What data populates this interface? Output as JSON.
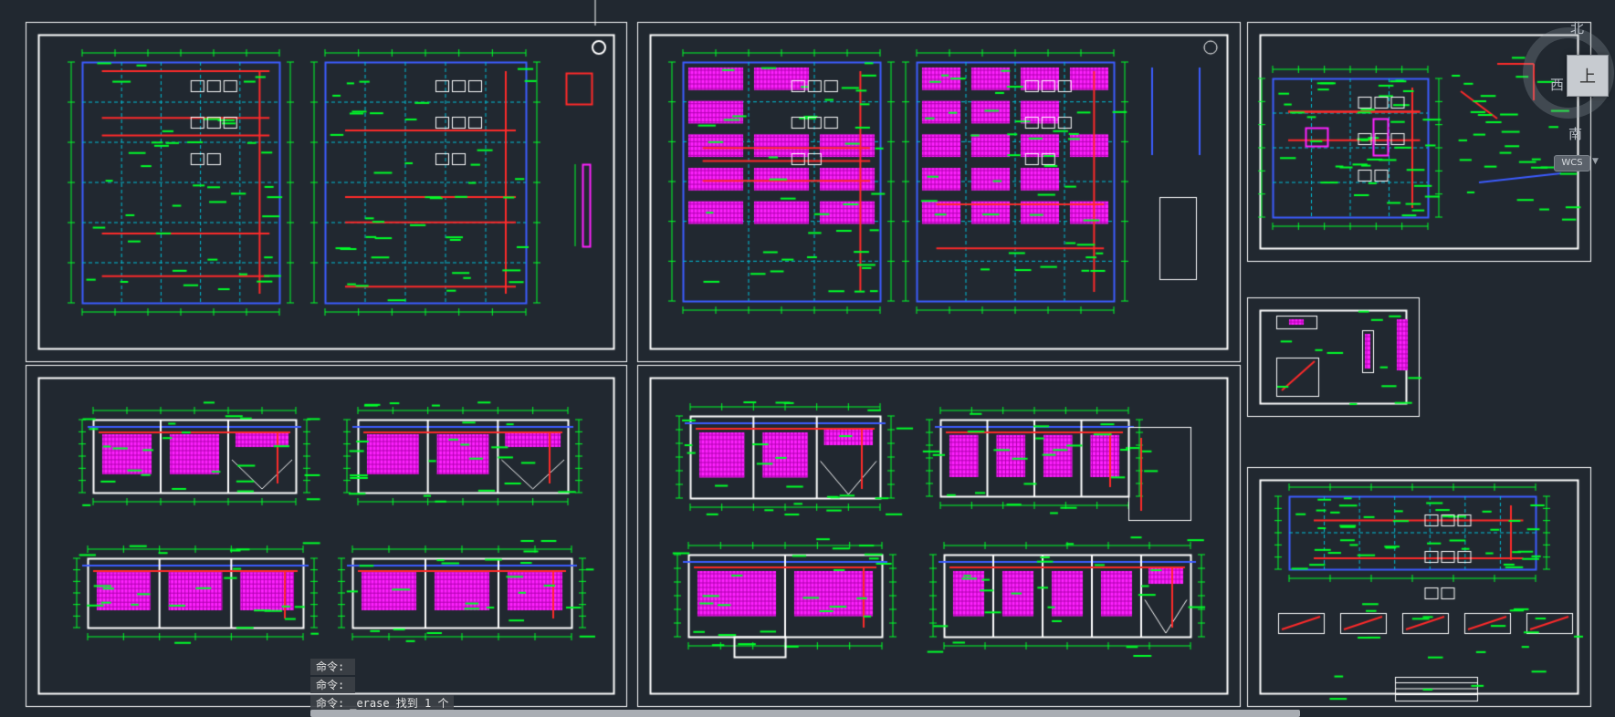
{
  "command_history": [
    {
      "prompt": "命令:",
      "text": ""
    },
    {
      "prompt": "命令:",
      "text": ""
    },
    {
      "prompt": "命令:",
      "text": "_erase 找到 1 个"
    }
  ],
  "viewcube": {
    "north": "北",
    "west": "西",
    "south": "南",
    "face": "上",
    "wcs": "WCS"
  },
  "colors": {
    "background": "#212830",
    "sheet_border": "#ffffff",
    "dimension": "#00ff2a",
    "wall_blue": "#3c5cff",
    "pipe_red": "#ff2a2a",
    "hatch_magenta": "#ff22ff",
    "axis_cyan": "#00c0d8",
    "axis_yellow": "#f0e000"
  }
}
